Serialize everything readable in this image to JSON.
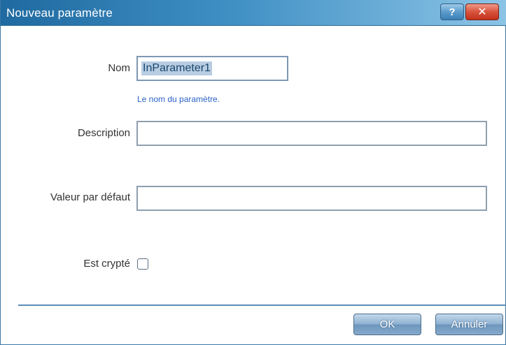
{
  "dialog": {
    "title": "Nouveau paramètre",
    "help_label": "?",
    "close_label": "✕"
  },
  "form": {
    "name_label": "Nom",
    "name_value": "InParameter1",
    "name_hint": "Le nom du paramètre.",
    "description_label": "Description",
    "description_value": "",
    "default_label": "Valeur par défaut",
    "default_value": "",
    "encrypted_label": "Est crypté",
    "encrypted_checked": false
  },
  "buttons": {
    "ok_label": "OK",
    "cancel_label": "Annuler"
  }
}
